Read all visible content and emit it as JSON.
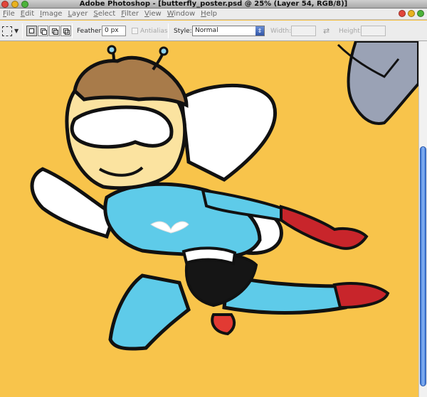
{
  "window": {
    "title": "Adobe Photoshop - [butterfly_poster.psd @ 25% (Layer 54, RGB/8)]",
    "controls": {
      "left": [
        "close",
        "minimize",
        "zoom"
      ],
      "colors": {
        "red": "#e2463a",
        "yellow": "#e9b21f",
        "green": "#4cb33a"
      }
    }
  },
  "menu": {
    "items": [
      "File",
      "Edit",
      "Image",
      "Layer",
      "Select",
      "Filter",
      "View",
      "Window",
      "Help"
    ]
  },
  "options": {
    "feather_label": "Feather:",
    "feather_value": "0 px",
    "antialias_label": "Antialias",
    "style_label": "Style:",
    "style_value": "Normal",
    "width_label": "Width:",
    "height_label": "Height:"
  },
  "canvas": {
    "background": "#f8c44b",
    "artwork": "butterfly superhero illustration"
  },
  "icons": {
    "marquee": "rectangular-marquee-icon",
    "new_selection": "new-selection-icon",
    "add_selection": "add-to-selection-icon",
    "subtract_selection": "subtract-from-selection-icon",
    "intersect_selection": "intersect-selection-icon",
    "swap": "swap-dimensions-icon",
    "dropdown": "dropdown-arrow-icon"
  }
}
